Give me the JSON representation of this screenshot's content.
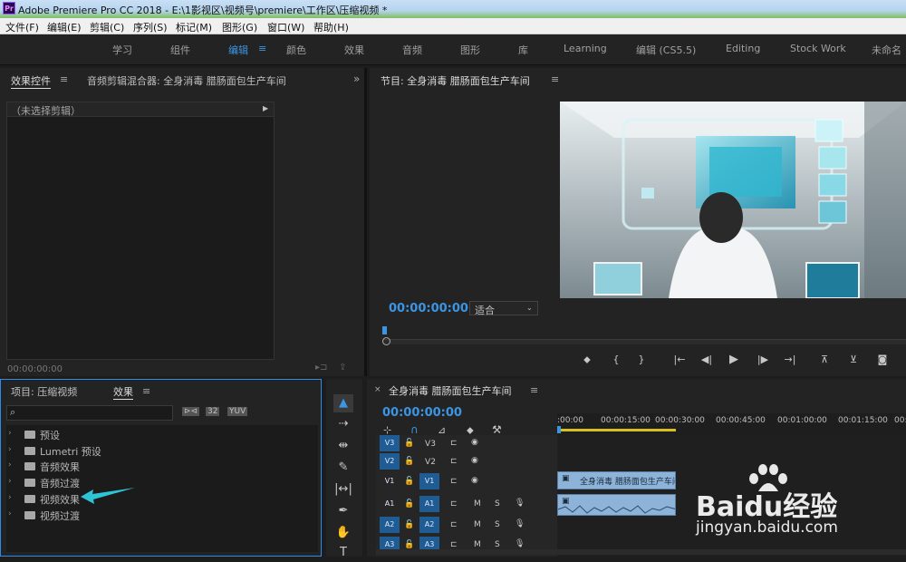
{
  "titlebar": {
    "logo": "Pr",
    "title": "Adobe Premiere Pro CC 2018 - E:\\1影视区\\视频号\\premiere\\工作区\\压缩视频 *"
  },
  "menu": [
    "文件(F)",
    "编辑(E)",
    "剪辑(C)",
    "序列(S)",
    "标记(M)",
    "图形(G)",
    "窗口(W)",
    "帮助(H)"
  ],
  "workspaces": [
    "学习",
    "组件",
    "编辑",
    "颜色",
    "效果",
    "音频",
    "图形",
    "库",
    "Learning",
    "编辑 (CS5.5)",
    "Editing",
    "Stock Work",
    "未命名"
  ],
  "active_workspace": "编辑",
  "source_panel": {
    "tab_active": "效果控件",
    "tab_other": "音频剪辑混合器: 全身消毒 腊肠面包生产车间",
    "no_clip": "（未选择剪辑）",
    "timecode": "00:00:00:00"
  },
  "program": {
    "title": "节目: 全身消毒 腊肠面包生产车间",
    "timecode": "00:00:00:00",
    "fit": "适合"
  },
  "project_panel": {
    "tab_project": "项目: 压缩视频",
    "tab_effects": "效果",
    "search_placeholder": "",
    "items": [
      "预设",
      "Lumetri 预设",
      "音频效果",
      "音频过渡",
      "视频效果",
      "视频过渡"
    ]
  },
  "timeline": {
    "title": "全身消毒 腊肠面包生产车间",
    "timecode": "00:00:00:00",
    "ruler": [
      ":00:00",
      "00:00:15:00",
      "00:00:30:00",
      "00:00:45:00",
      "00:01:00:00",
      "00:01:15:00",
      "00:"
    ],
    "tracks": [
      {
        "name": "V3",
        "target": "V3",
        "type": "video"
      },
      {
        "name": "V2",
        "target": "V2",
        "type": "video"
      },
      {
        "name": "V1",
        "target": "V1",
        "type": "video"
      },
      {
        "name": "A1",
        "target": "A1",
        "type": "audio"
      },
      {
        "name": "A2",
        "target": "A2",
        "type": "audio"
      },
      {
        "name": "A3",
        "target": "A3",
        "type": "audio"
      }
    ],
    "clip_label": "全身消毒 腊肠面包生产车间",
    "mute": "M",
    "solo": "S"
  },
  "watermark": {
    "brand": "Baidu经验",
    "url": "jingyan.baidu.com"
  },
  "colors": {
    "accent": "#3c95e3",
    "clip": "#8db3d9",
    "arrow": "#2ec4d6"
  }
}
